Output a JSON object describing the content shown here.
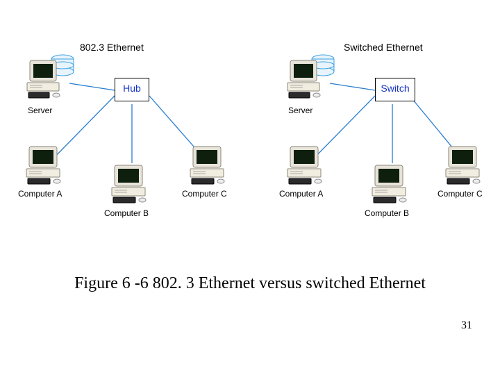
{
  "caption": "Figure 6 -6 802. 3 Ethernet versus switched Ethernet",
  "page_number": "31",
  "networks": [
    {
      "title": "802.3 Ethernet",
      "center_device_label": "Hub",
      "nodes": [
        "Server",
        "Computer A",
        "Computer B",
        "Computer C"
      ]
    },
    {
      "title": "Switched Ethernet",
      "center_device_label": "Switch",
      "nodes": [
        "Server",
        "Computer A",
        "Computer B",
        "Computer C"
      ]
    }
  ],
  "chart_data": {
    "type": "diagram",
    "title": "802.3 Ethernet versus switched Ethernet",
    "topologies": [
      {
        "name": "802.3 Ethernet",
        "center": "Hub",
        "endpoints": [
          "Server",
          "Computer A",
          "Computer B",
          "Computer C"
        ],
        "edges": [
          [
            "Hub",
            "Server"
          ],
          [
            "Hub",
            "Computer A"
          ],
          [
            "Hub",
            "Computer B"
          ],
          [
            "Hub",
            "Computer C"
          ]
        ]
      },
      {
        "name": "Switched Ethernet",
        "center": "Switch",
        "endpoints": [
          "Server",
          "Computer A",
          "Computer B",
          "Computer C"
        ],
        "edges": [
          [
            "Switch",
            "Server"
          ],
          [
            "Switch",
            "Computer A"
          ],
          [
            "Switch",
            "Computer B"
          ],
          [
            "Switch",
            "Computer C"
          ]
        ]
      }
    ]
  }
}
